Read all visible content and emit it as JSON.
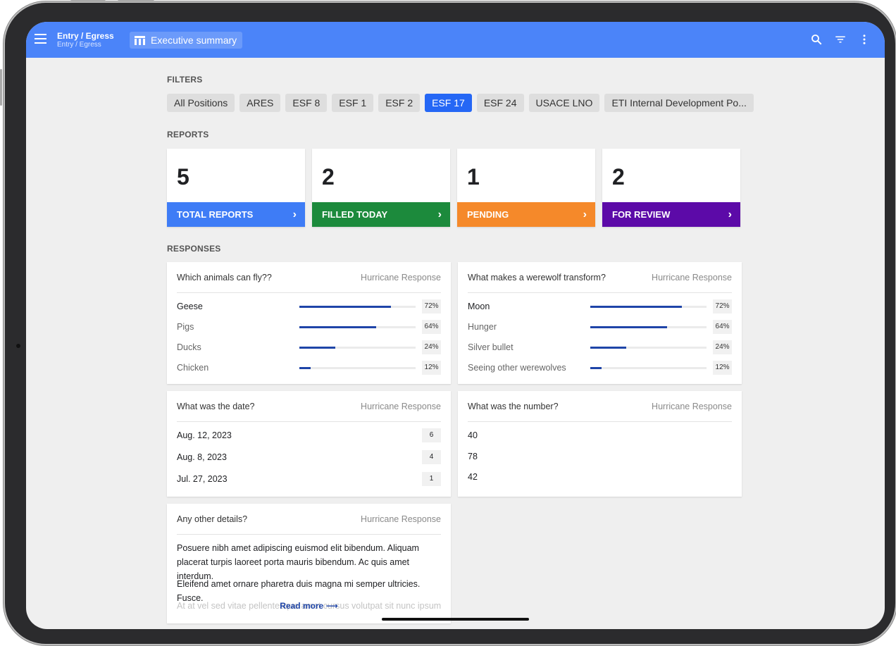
{
  "appbar": {
    "title": "Entry / Egress",
    "subtitle": "Entry / Egress",
    "exec_label": "Executive summary",
    "color": "#4b84f9"
  },
  "filters": {
    "label": "FILTERS",
    "active": "ESF 17",
    "chips": [
      "All Positions",
      "ARES",
      "ESF 8",
      "ESF 1",
      "ESF 2",
      "ESF 17",
      "ESF 24",
      "USACE LNO",
      "ETI Internal Development Po..."
    ]
  },
  "reports": {
    "label": "REPORTS",
    "cards": [
      {
        "count": "5",
        "label": "TOTAL REPORTS",
        "color": "#3e7cf6"
      },
      {
        "count": "2",
        "label": "FILLED TODAY",
        "color": "#1c8a3c"
      },
      {
        "count": "1",
        "label": "PENDING",
        "color": "#f5892a"
      },
      {
        "count": "2",
        "label": "FOR REVIEW",
        "color": "#5c0aa8"
      }
    ]
  },
  "responses": {
    "label": "RESPONSES",
    "animals": {
      "question": "Which animals can fly??",
      "tag": "Hurricane Response",
      "rows": [
        {
          "label": "Geese",
          "pct": "72%",
          "value": 0.79
        },
        {
          "label": "Pigs",
          "pct": "64%",
          "value": 0.66
        },
        {
          "label": "Ducks",
          "pct": "24%",
          "value": 0.31
        },
        {
          "label": "Chicken",
          "pct": "12%",
          "value": 0.1
        }
      ]
    },
    "werewolf": {
      "question": "What makes a werewolf transform?",
      "tag": "Hurricane Response",
      "rows": [
        {
          "label": "Moon",
          "pct": "72%",
          "value": 0.79
        },
        {
          "label": "Hunger",
          "pct": "64%",
          "value": 0.66
        },
        {
          "label": "Silver bullet",
          "pct": "24%",
          "value": 0.31
        },
        {
          "label": "Seeing other werewolves",
          "pct": "12%",
          "value": 0.1
        }
      ]
    },
    "date": {
      "question": "What was the date?",
      "tag": "Hurricane Response",
      "rows": [
        {
          "label": "Aug. 12, 2023",
          "count": "6"
        },
        {
          "label": "Aug. 8, 2023",
          "count": "4"
        },
        {
          "label": "Jul. 27, 2023",
          "count": "1"
        }
      ]
    },
    "number": {
      "question": "What was the number?",
      "tag": "Hurricane Response",
      "values": [
        "40",
        "78",
        "42"
      ]
    },
    "details": {
      "question": "Any other details?",
      "tag": "Hurricane Response",
      "para1": "Posuere nibh amet adipiscing euismod elit bibendum. Aliquam placerat turpis laoreet porta mauris bibendum. Ac quis amet interdum.",
      "para2": "Eleifend amet ornare pharetra duis magna mi semper ultricies. Fusce.",
      "para3": "At at vel sed vitae pellentesque amet cursus volutpat sit nunc ipsum.",
      "read_more": "Read more"
    }
  }
}
